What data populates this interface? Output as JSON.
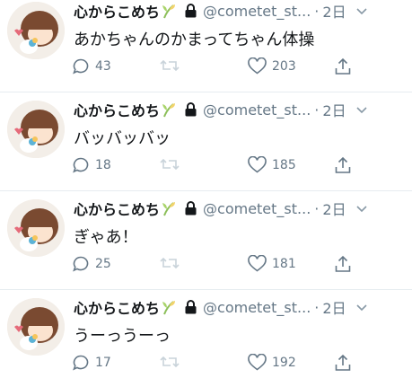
{
  "tweets": [
    {
      "name": "心からこめち",
      "handle": "@cometet_st...",
      "dot": "·",
      "time": "2日",
      "text": "あかちゃんのかまってちゃん体操",
      "replies": "43",
      "likes": "203"
    },
    {
      "name": "心からこめち",
      "handle": "@cometet_st...",
      "dot": "·",
      "time": "2日",
      "text": "バッバッバッ",
      "replies": "18",
      "likes": "185"
    },
    {
      "name": "心からこめち",
      "handle": "@cometet_st...",
      "dot": "·",
      "time": "2日",
      "text": "ぎゃあ！",
      "replies": "25",
      "likes": "181"
    },
    {
      "name": "心からこめち",
      "handle": "@cometet_st...",
      "dot": "·",
      "time": "2日",
      "text": "うーっうーっ",
      "replies": "17",
      "likes": "192"
    }
  ],
  "icons": {
    "lock": "lock-icon",
    "caret": "chevron-down-icon",
    "reply": "reply-icon",
    "retweet": "retweet-icon",
    "like": "heart-icon",
    "share": "share-icon",
    "badge": "sprout-emoji-icon"
  },
  "colors": {
    "text": "#14171a",
    "muted": "#657786",
    "divider": "#e6ecf0",
    "retweet_disabled": "#c9d3da"
  }
}
